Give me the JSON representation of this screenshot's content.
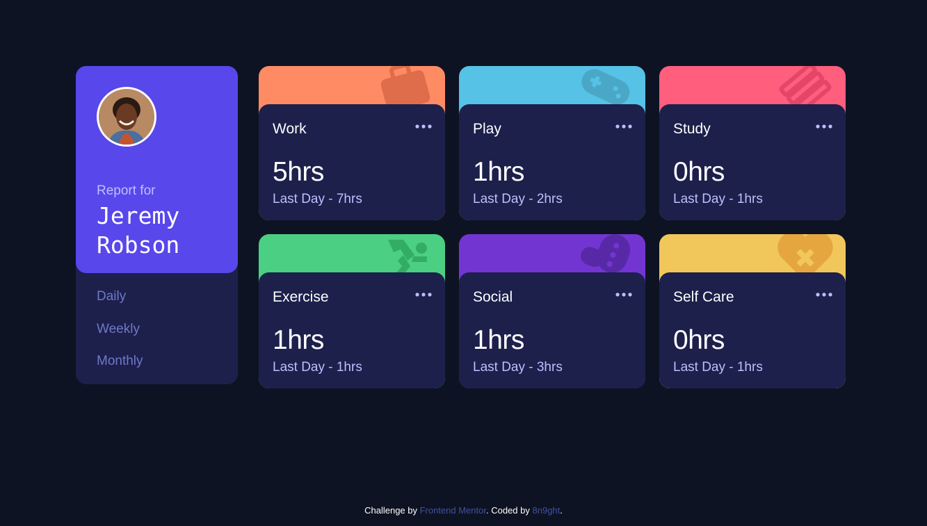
{
  "profile": {
    "report_for": "Report for",
    "name": "Jeremy Robson",
    "periods": [
      "Daily",
      "Weekly",
      "Monthly"
    ]
  },
  "colors": {
    "background": "#0e1323",
    "card": "#1c204b",
    "profile_accent": "#5847eb",
    "work": "#ff8b64",
    "play": "#55c2e6",
    "study": "#ff5e7d",
    "exercise": "#4bcf82",
    "social": "#7335d2",
    "self_care": "#f1c75b"
  },
  "cards": [
    {
      "title": "Work",
      "current": "5hrs",
      "previous": "Last Day - 7hrs",
      "icon": "briefcase-icon",
      "color": "#ff8b64"
    },
    {
      "title": "Play",
      "current": "1hrs",
      "previous": "Last Day - 2hrs",
      "icon": "gamepad-icon",
      "color": "#55c2e6"
    },
    {
      "title": "Study",
      "current": "0hrs",
      "previous": "Last Day - 1hrs",
      "icon": "books-icon",
      "color": "#ff5e7d"
    },
    {
      "title": "Exercise",
      "current": "1hrs",
      "previous": "Last Day - 1hrs",
      "icon": "running-icon",
      "color": "#4bcf82"
    },
    {
      "title": "Social",
      "current": "1hrs",
      "previous": "Last Day - 3hrs",
      "icon": "chat-icon",
      "color": "#7335d2"
    },
    {
      "title": "Self Care",
      "current": "0hrs",
      "previous": "Last Day - 1hrs",
      "icon": "heart-icon",
      "color": "#f1c75b"
    }
  ],
  "footer": {
    "prefix": "Challenge by ",
    "link1": "Frontend Mentor",
    "middle": ". Coded by ",
    "link2": "8n9ght",
    "suffix": "."
  }
}
